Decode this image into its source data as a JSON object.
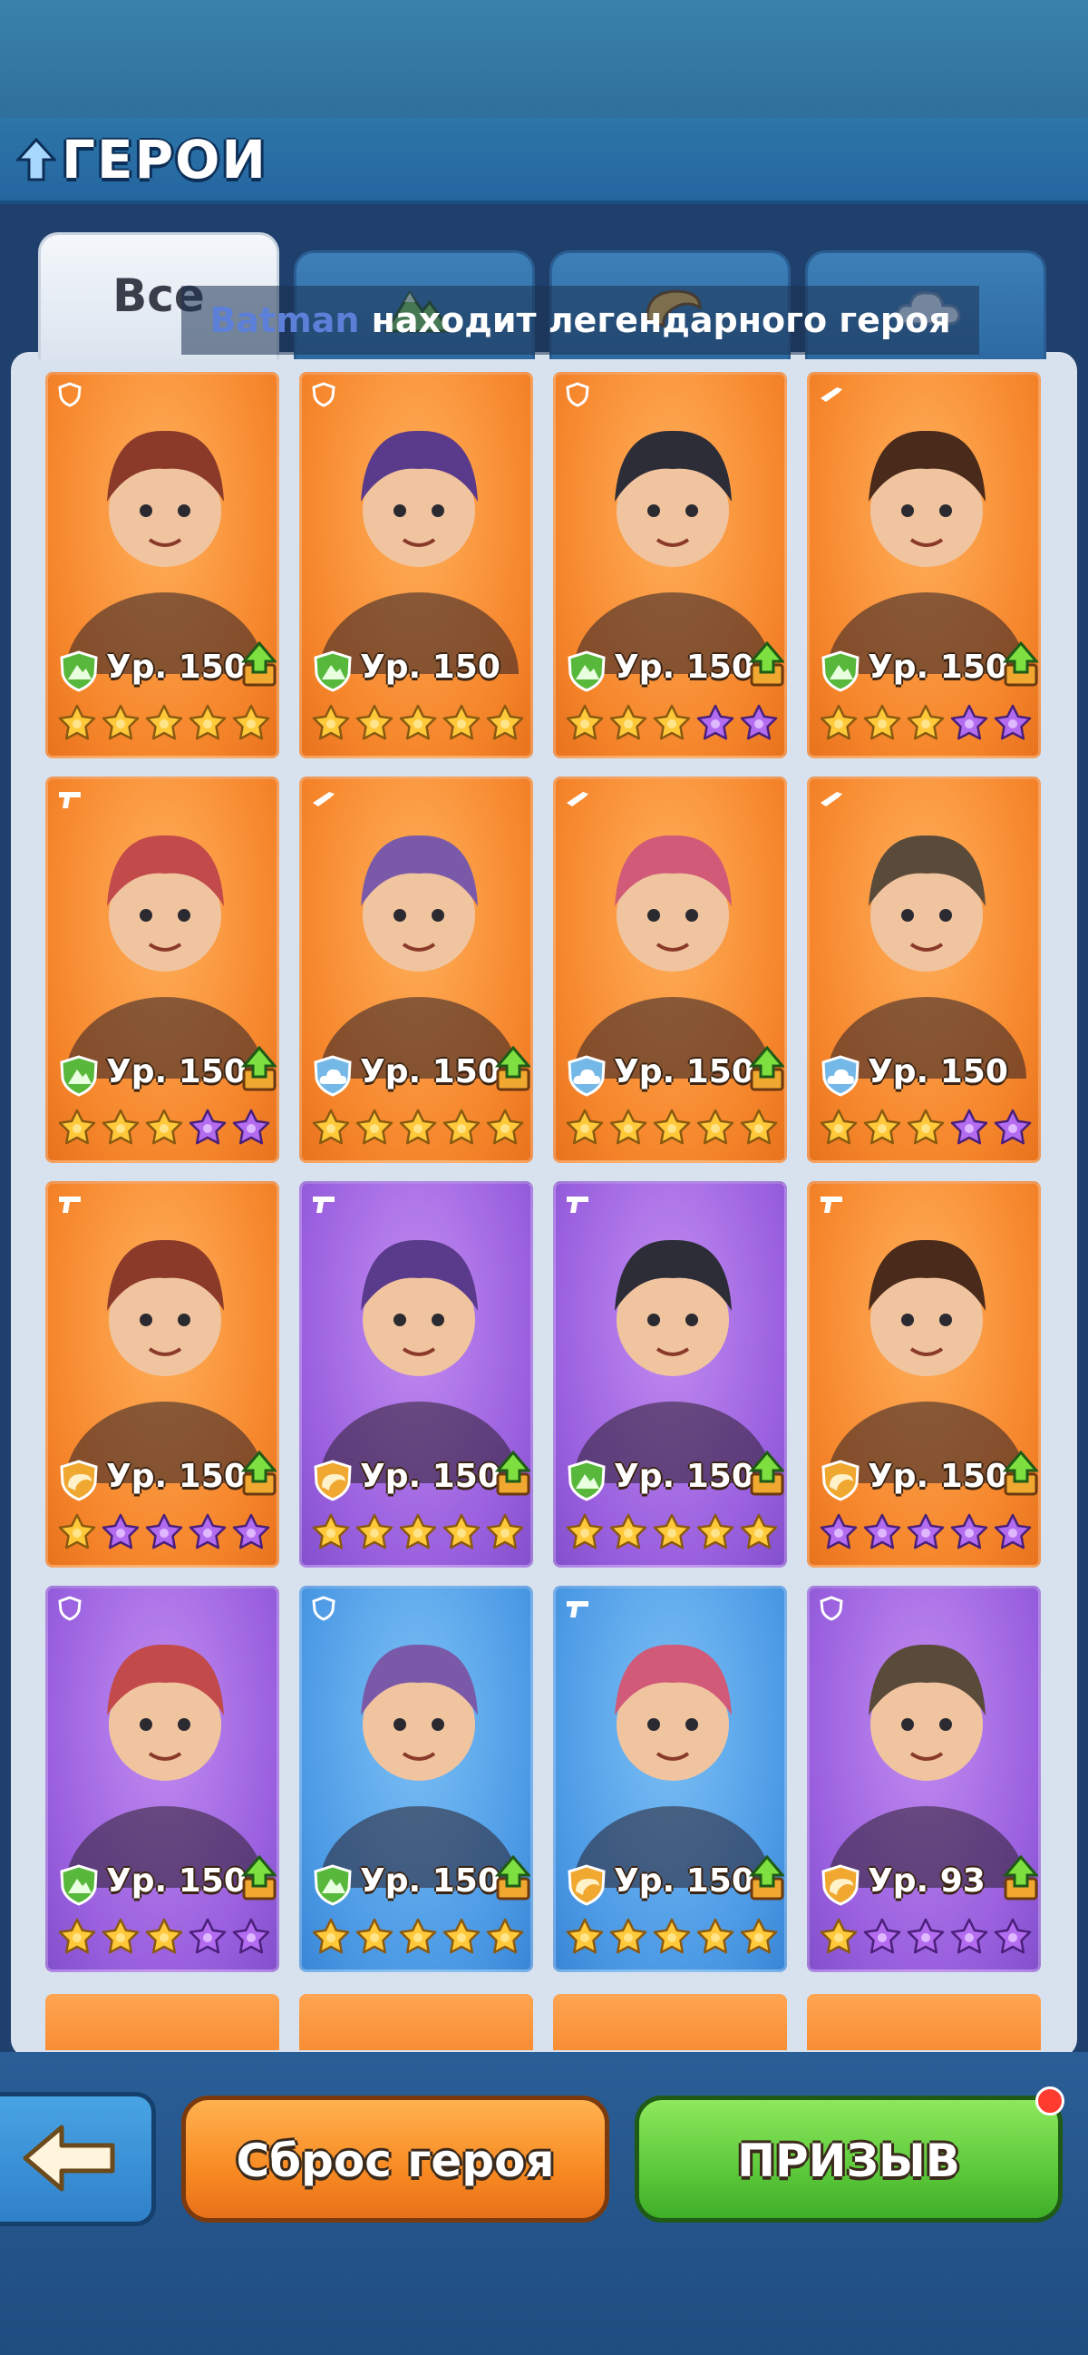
{
  "header": {
    "title": "ГЕРОИ"
  },
  "tabs": [
    {
      "label": "Все",
      "icon": "all-tab",
      "active": true
    },
    {
      "label": "",
      "icon": "mountain-icon",
      "active": false
    },
    {
      "label": "",
      "icon": "horn-icon",
      "active": false
    },
    {
      "label": "",
      "icon": "cloud-icon",
      "active": false
    }
  ],
  "banner": {
    "player": "Batman",
    "text": "находит легендарного героя"
  },
  "heroes": [
    {
      "level": "Ур. 150",
      "bg": "orange",
      "class": "mountain",
      "role": "shield",
      "gold_stars": 5,
      "purple_stars": 0,
      "upgrade": true
    },
    {
      "level": "Ур. 150",
      "bg": "orange",
      "class": "mountain",
      "role": "shield",
      "gold_stars": 5,
      "purple_stars": 0,
      "upgrade": false
    },
    {
      "level": "Ур. 150",
      "bg": "orange",
      "class": "mountain",
      "role": "shield",
      "gold_stars": 3,
      "purple_stars": 2,
      "upgrade": true
    },
    {
      "level": "Ур. 150",
      "bg": "orange",
      "class": "mountain",
      "role": "gun",
      "gold_stars": 3,
      "purple_stars": 2,
      "upgrade": true
    },
    {
      "level": "Ур. 150",
      "bg": "orange",
      "class": "mountain",
      "role": "pistol",
      "gold_stars": 3,
      "purple_stars": 2,
      "upgrade": true
    },
    {
      "level": "Ур. 150",
      "bg": "orange",
      "class": "cloud",
      "role": "gun",
      "gold_stars": 5,
      "purple_stars": 0,
      "upgrade": true
    },
    {
      "level": "Ур. 150",
      "bg": "orange",
      "class": "cloud",
      "role": "gun",
      "gold_stars": 5,
      "purple_stars": 0,
      "upgrade": true
    },
    {
      "level": "Ур. 150",
      "bg": "orange",
      "class": "cloud",
      "role": "gun",
      "gold_stars": 3,
      "purple_stars": 2,
      "upgrade": false
    },
    {
      "level": "Ур. 150",
      "bg": "orange",
      "class": "horn",
      "role": "pistol",
      "gold_stars": 1,
      "purple_stars": 4,
      "upgrade": true
    },
    {
      "level": "Ур. 150",
      "bg": "purple",
      "class": "horn",
      "role": "pistol",
      "gold_stars": 5,
      "purple_stars": 0,
      "upgrade": true
    },
    {
      "level": "Ур. 150",
      "bg": "purple",
      "class": "mountain",
      "role": "pistol",
      "gold_stars": 5,
      "purple_stars": 0,
      "upgrade": true
    },
    {
      "level": "Ур. 150",
      "bg": "orange",
      "class": "horn",
      "role": "pistol",
      "gold_stars": 0,
      "purple_stars": 5,
      "upgrade": true
    },
    {
      "level": "Ур. 150",
      "bg": "purple",
      "class": "mountain",
      "role": "shield",
      "gold_stars": 3,
      "purple_stars": 2,
      "upgrade": true
    },
    {
      "level": "Ур. 150",
      "bg": "blue",
      "class": "mountain",
      "role": "shield",
      "gold_stars": 5,
      "purple_stars": 0,
      "upgrade": true
    },
    {
      "level": "Ур. 150",
      "bg": "blue",
      "class": "horn",
      "role": "pistol",
      "gold_stars": 5,
      "purple_stars": 0,
      "upgrade": true
    },
    {
      "level": "Ур. 93",
      "bg": "purple",
      "class": "horn",
      "role": "shield",
      "gold_stars": 1,
      "purple_stars": 4,
      "upgrade": true
    }
  ],
  "footer": {
    "reset_label": "Сброс героя",
    "summon_label": "ПРИЗЫВ",
    "summon_notification": true
  },
  "colors": {
    "background": "#1f3f6c",
    "card_orange": "#f6862c",
    "card_purple": "#9a60df",
    "card_blue": "#4d9be6",
    "star_gold": "#ffc93a",
    "star_purple": "#b36cf0",
    "reset_button": "#f88a22",
    "summon_button": "#5cc93a"
  }
}
